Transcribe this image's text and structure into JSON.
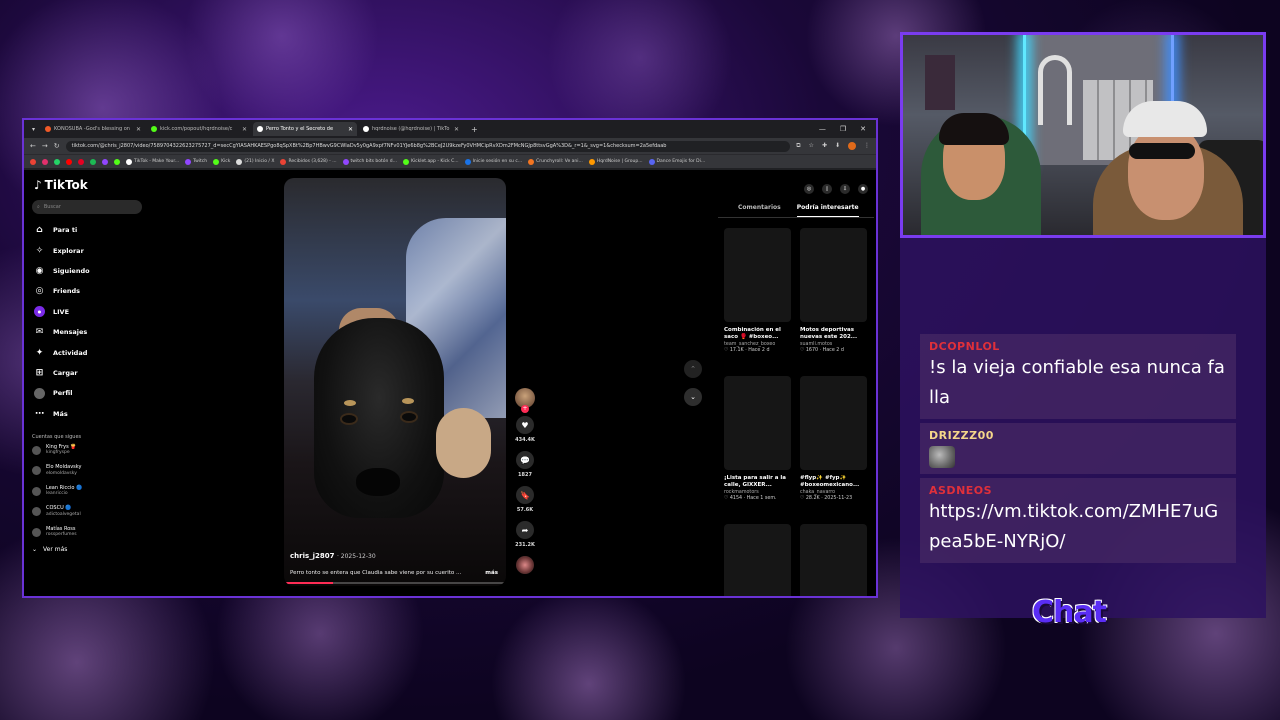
{
  "browser": {
    "tabs": [
      {
        "label": "KONOSUBA -God's blessing on",
        "color": "#f05a28",
        "active": false
      },
      {
        "label": "kick.com/popout/hqrdnoise/c",
        "color": "#53fc18",
        "active": false
      },
      {
        "label": "Perro Tonto y el Secreto de",
        "color": "#ffffff",
        "active": true
      },
      {
        "label": "hqrdnoise (@hqrdnoise) | TikTo",
        "color": "#ffffff",
        "active": false
      }
    ],
    "new_tab": "+",
    "url": "tiktok.com/@chris_j2807/video/7589704322623275727_d=secCgYIASAHKAESPgo8qSpXBt%2Bp7HBwvG9CWIaDv5y0gA9xpf7NFv01YJe6b8g%2BCeJ2U9kzeFy0VHMCipRvXDm2FMcNGJp8ttsvGgA%3D&_r=1&_svg=1&checksum=2a5efdaab",
    "bookmarks": [
      {
        "label": "TikTok - Make Your...",
        "color": "#fff"
      },
      {
        "label": "Twitch",
        "color": "#9146ff"
      },
      {
        "label": "Kick",
        "color": "#53fc18"
      },
      {
        "label": "(21) Inicio / X",
        "color": "#ddd"
      },
      {
        "label": "Recibidos (3,628) - ...",
        "color": "#ea4335"
      },
      {
        "label": "twitch bits botón d...",
        "color": "#9146ff"
      },
      {
        "label": "Kicklet.app - Kick C...",
        "color": "#53fc18"
      },
      {
        "label": "Inicie sesión en su c...",
        "color": "#1a73e8"
      },
      {
        "label": "Crunchyroll: Ve ani...",
        "color": "#f47521"
      },
      {
        "label": "HqrdNoise | Group...",
        "color": "#ff9900"
      },
      {
        "label": "Dance Emojis for Di...",
        "color": "#5865f2"
      }
    ]
  },
  "tiktok": {
    "logo": "TikTok",
    "search_placeholder": "Buscar",
    "menu": [
      {
        "label": "Para ti",
        "icon": "home-icon"
      },
      {
        "label": "Explorar",
        "icon": "compass-icon"
      },
      {
        "label": "Siguiendo",
        "icon": "following-icon"
      },
      {
        "label": "Friends",
        "icon": "friends-icon"
      },
      {
        "label": "LIVE",
        "icon": "live-icon"
      },
      {
        "label": "Mensajes",
        "icon": "messages-icon"
      },
      {
        "label": "Actividad",
        "icon": "activity-icon"
      },
      {
        "label": "Cargar",
        "icon": "upload-icon"
      },
      {
        "label": "Perfil",
        "icon": "profile-icon"
      },
      {
        "label": "Más",
        "icon": "more-icon"
      }
    ],
    "following_title": "Cuentas que sigues",
    "following": [
      {
        "name": "King Frys 🍟",
        "handle": "kingfryspe"
      },
      {
        "name": "Elo Moldavsky",
        "handle": "elomoldavsky"
      },
      {
        "name": "Lean Riccio 🔵",
        "handle": "leanriccio"
      },
      {
        "name": "COSCU 🔵",
        "handle": "adictoalvegetal"
      },
      {
        "name": "Matías Ross",
        "handle": "rossperfumes"
      }
    ],
    "see_more": "Ver más",
    "video": {
      "author": "chris_j2807",
      "date": "· 2025-12-30",
      "caption": "Perro tonto se entera que Claudia sabe viene por su cuerito ...",
      "more": "más",
      "progress": 0.22
    },
    "actions": [
      {
        "icon": "heart-icon",
        "count": "434.4K"
      },
      {
        "icon": "comment-icon",
        "count": "1827"
      },
      {
        "icon": "bookmark-icon",
        "count": "57.6K"
      },
      {
        "icon": "share-icon",
        "count": "231.2K"
      }
    ],
    "right_tabs": [
      "Comentarios",
      "Podría interesarte"
    ],
    "cards": [
      {
        "title": "Combinación en el saco 🥊 #boxeo...",
        "user": "team_sanchez_boxeo",
        "likes": "17.1K",
        "date": "Hace 2 d"
      },
      {
        "title": "Motos deportivas nuevas este 202...",
        "user": "suamli.motos",
        "likes": "1670",
        "date": "Hace 2 d"
      },
      {
        "title": "¡Lista para salir a la calle, GIXXER...",
        "user": "rockmamotors",
        "likes": "4154",
        "date": "Hace 1 sem."
      },
      {
        "title": "#flyp✨ #fyp✨ #boxeomexicano...",
        "user": "chaka_navarro",
        "likes": "28.2K",
        "date": "2025-11-23"
      }
    ]
  },
  "chat": {
    "messages": [
      {
        "user": "DCOPNLOL",
        "user_color": "#e0303a",
        "text": "!s la vieja confiable esa nunca falla",
        "emote": false
      },
      {
        "user": "DRIZZZ00",
        "user_color": "#f5d68a",
        "text": "",
        "emote": true
      },
      {
        "user": "ASDNEOS",
        "user_color": "#e0303a",
        "text": "https://vm.tiktok.com/ZMHE7uGpea5bE-NYRjO/",
        "emote": false
      }
    ],
    "label": "Chat"
  }
}
